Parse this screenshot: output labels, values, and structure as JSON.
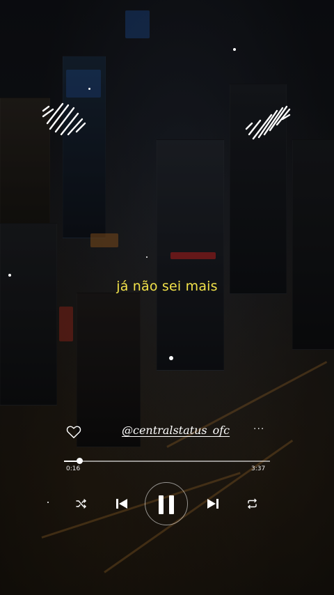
{
  "lyric": {
    "text": "já não sei mais"
  },
  "track": {
    "handle": "@centralstatus_ofc",
    "liked": false,
    "more_label": "···"
  },
  "player": {
    "current_time": "0:16",
    "duration": "3:37",
    "progress_fraction": 0.074,
    "state": "playing"
  },
  "icons": {
    "waveform_left": "sound-wave-icon",
    "waveform_right": "sound-wave-icon",
    "heart": "heart-outline-icon",
    "more": "more-dots-icon",
    "shuffle": "shuffle-icon",
    "previous": "skip-previous-icon",
    "pause": "pause-icon",
    "next": "skip-next-icon",
    "repeat": "repeat-icon"
  },
  "colors": {
    "lyric": "#f2e24a",
    "foreground": "#ffffff",
    "background": "#0b0c10"
  }
}
